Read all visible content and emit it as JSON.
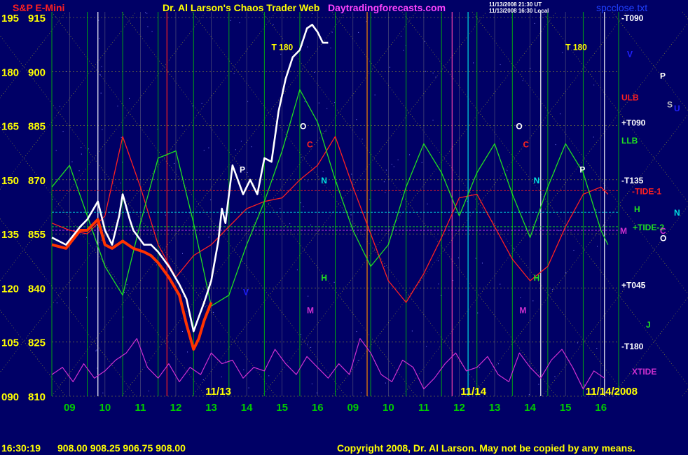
{
  "header": {
    "instrument": "S&P E-Mini",
    "title": "Dr. Al Larson's Chaos Trader Web",
    "site": "Daytradingforecasts.com",
    "stamp_ut": "11/13/2008 21:30 UT",
    "stamp_local": "11/13/2008 16:30 Local",
    "file": "spcclose.txt"
  },
  "footer": {
    "time": "16:30:19",
    "quote": "908.00 908.25 906.75 908.00",
    "copyright": "Copyright 2008, Dr. Al Larson. May not be copied by any means."
  },
  "colors": {
    "background": "#000066",
    "price": "#ffffff",
    "lows": "#ff3300",
    "flux_red": "#ff2020",
    "flux_green": "#20e020",
    "xtide": "#d030d0",
    "grid_yellow": "#ffff00",
    "grid_green": "#00cc00"
  },
  "chart_data": {
    "type": "line",
    "title": "S&P E-Mini",
    "y_left_labels": [
      "195",
      "180",
      "165",
      "150",
      "135",
      "120",
      "105",
      "090"
    ],
    "y_right_labels": [
      "915",
      "900",
      "885",
      "870",
      "855",
      "840",
      "825",
      "810"
    ],
    "ylim": [
      810,
      915
    ],
    "x_hour_labels": [
      "09",
      "10",
      "11",
      "12",
      "13",
      "14",
      "15",
      "16",
      "09",
      "10",
      "11",
      "12",
      "13",
      "14",
      "15",
      "16"
    ],
    "date_labels": [
      "11/13",
      "11/14",
      "11/14/2008"
    ],
    "right_markers": [
      {
        "text": "-T090",
        "value": 915,
        "color": "#ffffff"
      },
      {
        "text": "V",
        "value": 905,
        "color": "#2020ff"
      },
      {
        "text": "P",
        "value": 899,
        "color": "#ffffff"
      },
      {
        "text": "ULB",
        "value": 893,
        "color": "#ff2020"
      },
      {
        "text": "S",
        "value": 891,
        "color": "#c0c0c0"
      },
      {
        "text": "U",
        "value": 890,
        "color": "#2020ff"
      },
      {
        "text": "+T090",
        "value": 886,
        "color": "#ffffff"
      },
      {
        "text": "LLB",
        "value": 881,
        "color": "#20e020"
      },
      {
        "text": "-T135",
        "value": 870,
        "color": "#ffffff"
      },
      {
        "text": "-TIDE-1",
        "value": 867,
        "color": "#ff2020"
      },
      {
        "text": "H",
        "value": 862,
        "color": "#20e020"
      },
      {
        "text": "N",
        "value": 861,
        "color": "#00e0e0"
      },
      {
        "text": "M",
        "value": 856,
        "color": "#d030d0"
      },
      {
        "text": "+TIDE-2",
        "value": 857,
        "color": "#20e020"
      },
      {
        "text": "C",
        "value": 856,
        "color": "#d030d0"
      },
      {
        "text": "O",
        "value": 854,
        "color": "#ffffff"
      },
      {
        "text": "+T045",
        "value": 841,
        "color": "#ffffff"
      },
      {
        "text": "J",
        "value": 830,
        "color": "#20e020"
      },
      {
        "text": "-T180",
        "value": 824,
        "color": "#ffffff"
      },
      {
        "text": "XTIDE",
        "value": 817,
        "color": "#d030d0"
      }
    ],
    "chart_labels": [
      {
        "text": "T 180",
        "x": 6.2,
        "value": 906,
        "color": "#ffff00"
      },
      {
        "text": "T 180",
        "x": 14.5,
        "value": 906,
        "color": "#ffff00"
      },
      {
        "text": "O",
        "x": 7.0,
        "value": 884,
        "color": "#ffffff"
      },
      {
        "text": "O",
        "x": 13.1,
        "value": 884,
        "color": "#ffffff"
      },
      {
        "text": "C",
        "x": 7.2,
        "value": 879,
        "color": "#ff2020"
      },
      {
        "text": "C",
        "x": 13.3,
        "value": 879,
        "color": "#ff2020"
      },
      {
        "text": "P",
        "x": 5.3,
        "value": 872,
        "color": "#ffffff"
      },
      {
        "text": "P",
        "x": 14.9,
        "value": 872,
        "color": "#ffffff"
      },
      {
        "text": "N",
        "x": 7.6,
        "value": 869,
        "color": "#00e0e0"
      },
      {
        "text": "N",
        "x": 13.6,
        "value": 869,
        "color": "#00e0e0"
      },
      {
        "text": "H",
        "x": 7.6,
        "value": 842,
        "color": "#20e020"
      },
      {
        "text": "H",
        "x": 13.6,
        "value": 842,
        "color": "#20e020"
      },
      {
        "text": "M",
        "x": 7.2,
        "value": 833,
        "color": "#d030d0"
      },
      {
        "text": "M",
        "x": 13.2,
        "value": 833,
        "color": "#d030d0"
      },
      {
        "text": "V",
        "x": 5.4,
        "value": 838,
        "color": "#2020ff"
      }
    ],
    "series": [
      {
        "name": "price",
        "x": [
          0,
          0.4,
          0.8,
          1.0,
          1.3,
          1.5,
          1.7,
          1.9,
          2.0,
          2.2,
          2.3,
          2.6,
          2.8,
          3.0,
          3.3,
          3.6,
          3.8,
          4.0,
          4.15,
          4.3,
          4.5,
          4.7,
          4.8,
          4.9,
          5.1,
          5.4,
          5.6,
          5.8,
          6.0,
          6.2,
          6.4,
          6.6,
          6.8,
          7.0,
          7.2,
          7.35,
          7.5,
          7.65,
          7.8
        ],
        "values": [
          854,
          852,
          857,
          859,
          864,
          856,
          852,
          860,
          866,
          859,
          856,
          852,
          852,
          850,
          846,
          841,
          837,
          828,
          832,
          836,
          842,
          853,
          862,
          858,
          874,
          866,
          870,
          866,
          876,
          875,
          889,
          898,
          904,
          906,
          912,
          913,
          911,
          908,
          908
        ]
      },
      {
        "name": "lows",
        "x": [
          0,
          0.4,
          0.8,
          1.0,
          1.3,
          1.5,
          1.7,
          2.0,
          2.3,
          2.6,
          2.8,
          3.0,
          3.3,
          3.6,
          3.8,
          4.0,
          4.15,
          4.3,
          4.5
        ],
        "values": [
          852,
          851,
          856,
          856,
          859,
          852,
          851,
          853,
          851,
          850,
          849,
          847,
          843,
          838,
          830,
          823,
          826,
          831,
          836
        ]
      },
      {
        "name": "flux-red",
        "x": [
          0,
          0.5,
          1.0,
          1.5,
          2.0,
          2.5,
          3.0,
          3.5,
          4.0,
          4.5,
          5.0,
          5.5,
          6.0,
          6.5,
          7.0,
          7.5,
          8.0,
          8.5,
          9.0,
          9.5,
          10.0,
          10.5,
          11.0,
          11.5,
          12.0,
          12.5,
          13.0,
          13.5,
          14.0,
          14.5,
          15.0,
          15.5,
          15.7
        ],
        "values": [
          858,
          856,
          855,
          860,
          882,
          868,
          852,
          843,
          849,
          852,
          857,
          862,
          864,
          865,
          870,
          874,
          882,
          868,
          855,
          842,
          836,
          844,
          854,
          865,
          866,
          857,
          848,
          842,
          846,
          857,
          866,
          868,
          866
        ]
      },
      {
        "name": "flux-green",
        "x": [
          0,
          0.5,
          1.0,
          1.5,
          2.0,
          2.5,
          3.0,
          3.5,
          4.0,
          4.5,
          5.0,
          5.5,
          6.0,
          6.5,
          7.0,
          7.5,
          8.0,
          8.5,
          9.0,
          9.5,
          10.0,
          10.5,
          11.0,
          11.5,
          12.0,
          12.5,
          13.0,
          13.5,
          14.0,
          14.5,
          15.0,
          15.5,
          15.7
        ],
        "values": [
          868,
          874,
          860,
          846,
          838,
          858,
          876,
          878,
          858,
          835,
          838,
          852,
          864,
          878,
          895,
          886,
          870,
          856,
          846,
          852,
          868,
          880,
          872,
          860,
          872,
          880,
          866,
          854,
          868,
          880,
          872,
          856,
          852
        ]
      },
      {
        "name": "xtide",
        "x": [
          0,
          0.3,
          0.6,
          0.9,
          1.2,
          1.5,
          1.8,
          2.1,
          2.4,
          2.7,
          3.0,
          3.3,
          3.6,
          3.9,
          4.2,
          4.5,
          4.8,
          5.1,
          5.4,
          5.7,
          6.0,
          6.3,
          6.6,
          6.9,
          7.2,
          7.5,
          7.8,
          8.1,
          8.4,
          8.7,
          9.0,
          9.3,
          9.6,
          9.9,
          10.2,
          10.5,
          10.8,
          11.1,
          11.4,
          11.7,
          12.0,
          12.3,
          12.6,
          12.9,
          13.2,
          13.5,
          13.8,
          14.1,
          14.4,
          14.7,
          15.0,
          15.3,
          15.6
        ],
        "values": [
          816,
          818,
          814,
          819,
          815,
          817,
          820,
          822,
          826,
          818,
          815,
          819,
          814,
          818,
          816,
          822,
          819,
          820,
          815,
          818,
          817,
          823,
          819,
          816,
          821,
          818,
          815,
          819,
          816,
          826,
          822,
          816,
          814,
          820,
          818,
          812,
          815,
          819,
          822,
          817,
          818,
          821,
          816,
          814,
          822,
          818,
          815,
          820,
          823,
          818,
          812,
          817,
          815
        ]
      }
    ],
    "grid": true,
    "legend": "none"
  }
}
